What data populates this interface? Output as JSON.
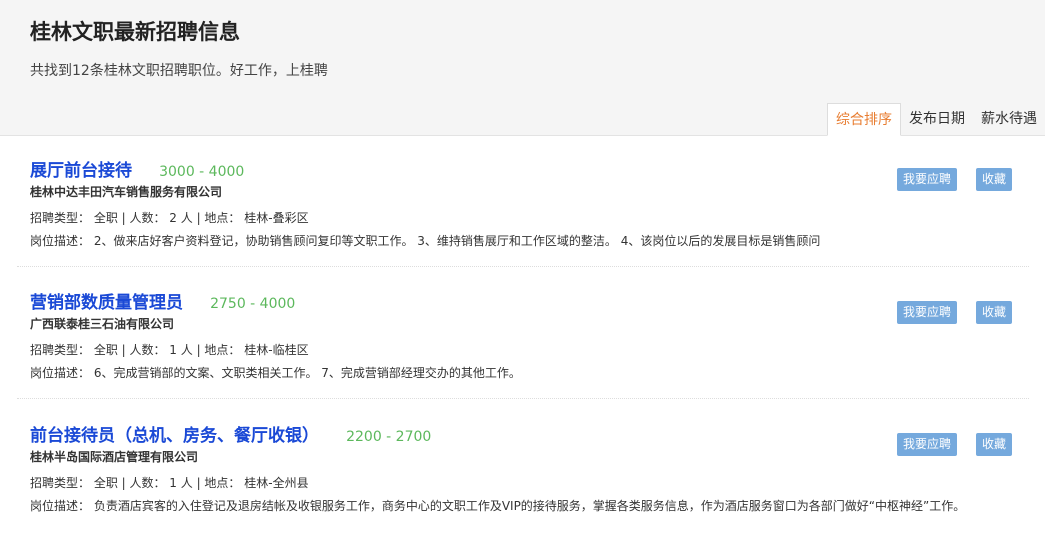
{
  "header": {
    "title": "桂林文职最新招聘信息",
    "subtitle": "共找到12条桂林文职招聘职位。好工作，上桂聘"
  },
  "sort_tabs": [
    {
      "label": "综合排序",
      "active": true
    },
    {
      "label": "发布日期",
      "active": false
    },
    {
      "label": "薪水待遇",
      "active": false
    }
  ],
  "buttons": {
    "apply_label": "我要应聘",
    "favorite_label": "收藏"
  },
  "jobs": [
    {
      "title": "展厅前台接待",
      "salary": "3000 - 4000",
      "company": "桂林中达丰田汽车销售服务有限公司",
      "meta": "招聘类型：  全职 | 人数：  2 人 | 地点：  桂林-叠彩区",
      "description": "岗位描述：  2、做来店好客户资料登记，协助销售顾问复印等文职工作。 3、维持销售展厅和工作区域的整洁。 4、该岗位以后的发展目标是销售顾问"
    },
    {
      "title": "营销部数质量管理员",
      "salary": "2750 - 4000",
      "company": "广西联泰桂三石油有限公司",
      "meta": "招聘类型：  全职 | 人数：  1 人 | 地点：  桂林-临桂区",
      "description": "岗位描述：  6、完成营销部的文案、文职类相关工作。 7、完成营销部经理交办的其他工作。"
    },
    {
      "title": "前台接待员（总机、房务、餐厅收银）",
      "salary": "2200 - 2700",
      "company": "桂林半岛国际酒店管理有限公司",
      "meta": "招聘类型：  全职 | 人数：  1 人 | 地点：  桂林-全州县",
      "description": "岗位描述：  负责酒店宾客的入住登记及退房结帐及收银服务工作，商务中心的文职工作及VIP的接待服务，掌握各类服务信息，作为酒店服务窗口为各部门做好“中枢神经”工作。"
    }
  ]
}
